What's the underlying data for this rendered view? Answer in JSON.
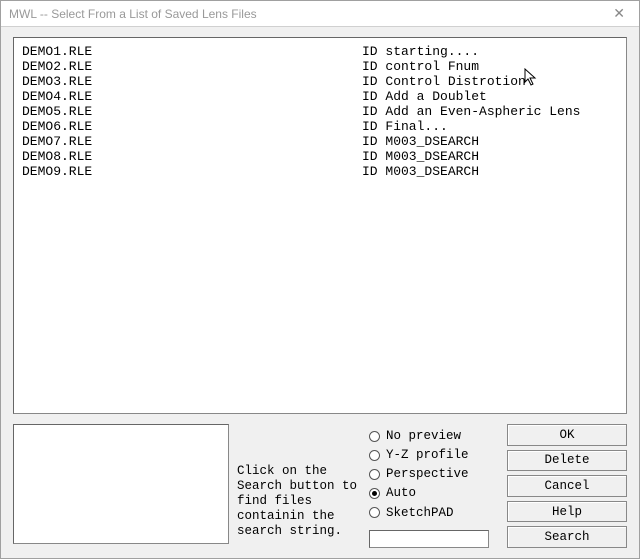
{
  "window": {
    "title": "MWL -- Select From a List of Saved Lens Files"
  },
  "list": {
    "rows": [
      {
        "file": "DEMO1.RLE",
        "desc": "ID starting...."
      },
      {
        "file": "DEMO2.RLE",
        "desc": "ID control Fnum"
      },
      {
        "file": "DEMO3.RLE",
        "desc": "ID Control Distrotion"
      },
      {
        "file": "DEMO4.RLE",
        "desc": "ID Add a Doublet"
      },
      {
        "file": "DEMO5.RLE",
        "desc": "ID Add an Even-Aspheric Lens"
      },
      {
        "file": "DEMO6.RLE",
        "desc": "ID Final..."
      },
      {
        "file": "DEMO7.RLE",
        "desc": "ID M003_DSEARCH"
      },
      {
        "file": "DEMO8.RLE",
        "desc": "ID M003_DSEARCH"
      },
      {
        "file": "DEMO9.RLE",
        "desc": "ID M003_DSEARCH"
      }
    ]
  },
  "hint": "Click on the Search button to find files containin the search string.",
  "radios": {
    "options": [
      {
        "label": "No preview",
        "selected": false
      },
      {
        "label": "Y-Z profile",
        "selected": false
      },
      {
        "label": "Perspective",
        "selected": false
      },
      {
        "label": "Auto",
        "selected": true
      },
      {
        "label": "SketchPAD",
        "selected": false
      }
    ]
  },
  "search": {
    "value": ""
  },
  "buttons": {
    "ok": "OK",
    "delete": "Delete",
    "cancel": "Cancel",
    "help": "Help",
    "search": "Search"
  }
}
